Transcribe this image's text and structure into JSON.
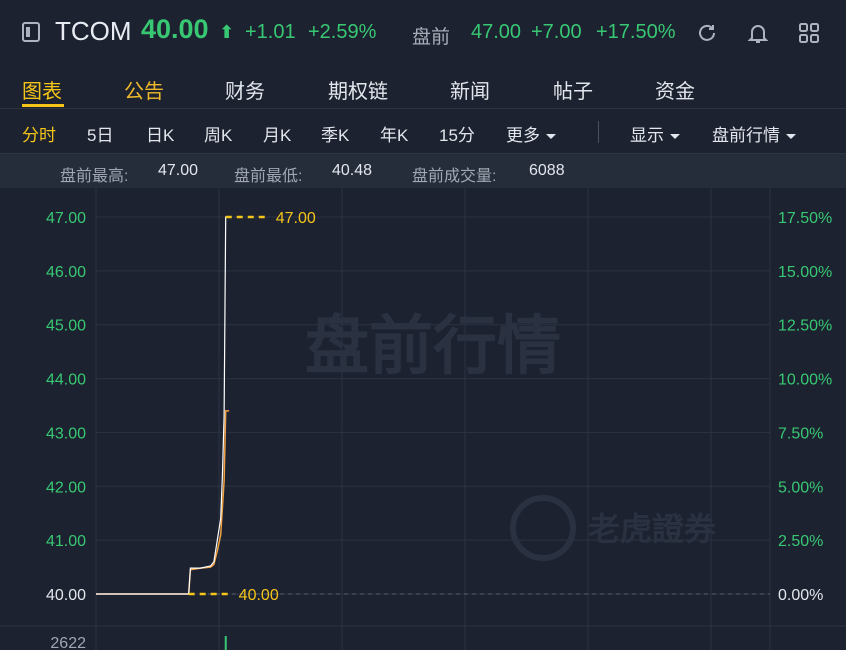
{
  "header": {
    "symbol": "TCOM",
    "price": "40.00",
    "arrow": "⬆",
    "change": "+1.01",
    "change_pct": "+2.59%",
    "premarket_label": "盘前",
    "premarket_price": "47.00",
    "premarket_change": "+7.00",
    "premarket_change_pct": "+17.50%"
  },
  "tabs": [
    "图表",
    "公告",
    "财务",
    "期权链",
    "新闻",
    "帖子",
    "资金"
  ],
  "periods": [
    "分时",
    "5日",
    "日K",
    "周K",
    "月K",
    "季K",
    "年K",
    "15分",
    "更多"
  ],
  "controls": {
    "display": "显示",
    "premarket_quote": "盘前行情"
  },
  "stats": {
    "high_label": "盘前最高:",
    "high": "47.00",
    "low_label": "盘前最低:",
    "low": "40.48",
    "volume_label": "盘前成交量:",
    "volume": "6088"
  },
  "chart_data": {
    "type": "line",
    "y_labels": [
      "47.00",
      "46.00",
      "45.00",
      "44.00",
      "43.00",
      "42.00",
      "41.00",
      "40.00"
    ],
    "pct_labels": [
      "17.50%",
      "15.00%",
      "12.50%",
      "10.00%",
      "7.50%",
      "5.00%",
      "2.50%",
      "0.00%"
    ],
    "ylim": [
      40.0,
      47.0
    ],
    "x": [
      0,
      55,
      56,
      62,
      68,
      70,
      72,
      74,
      75,
      76,
      77,
      78,
      79
    ],
    "price": [
      40.0,
      40.0,
      40.48,
      40.48,
      40.52,
      40.6,
      41.0,
      41.4,
      42.2,
      43.3,
      47.0,
      47.0,
      47.0
    ],
    "avg": [
      40.0,
      40.0,
      40.45,
      40.48,
      40.5,
      40.55,
      40.8,
      41.1,
      41.6,
      42.1,
      43.4,
      43.4,
      43.4
    ],
    "high_marker": "47.00",
    "prev_close_marker": "40.00",
    "watermark": "盘前行情",
    "brand_watermark": "老虎證券",
    "volume_label": "2622",
    "colors": {
      "price_line": "#ffffff",
      "avg_line": "#f0a040",
      "marker": "#f5c518",
      "axis_green": "#38c873"
    }
  }
}
